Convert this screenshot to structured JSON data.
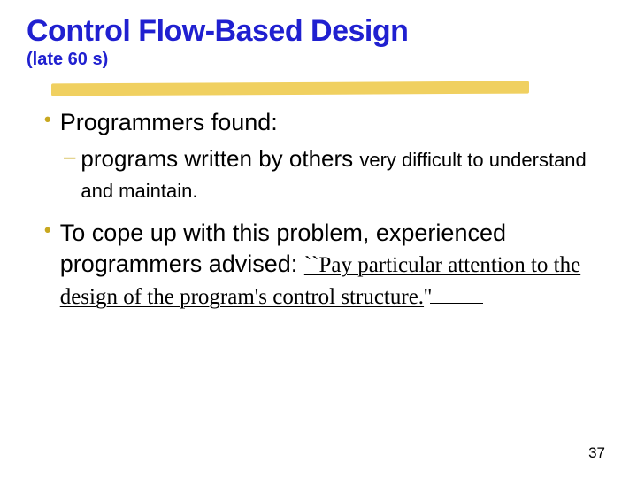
{
  "title": "Control Flow-Based Design",
  "subtitle": "(late 60 s)",
  "bullet1": "Programmers found:",
  "sub1_a": "programs written by others ",
  "sub1_b": "very difficult to understand and maintain.",
  "bullet2_a": "To cope up with this problem, experienced programmers advised: ",
  "bullet2_b": "``Pay particular attention to the design of the program's  control structure.",
  "bullet2_c": "''",
  "page": "37"
}
